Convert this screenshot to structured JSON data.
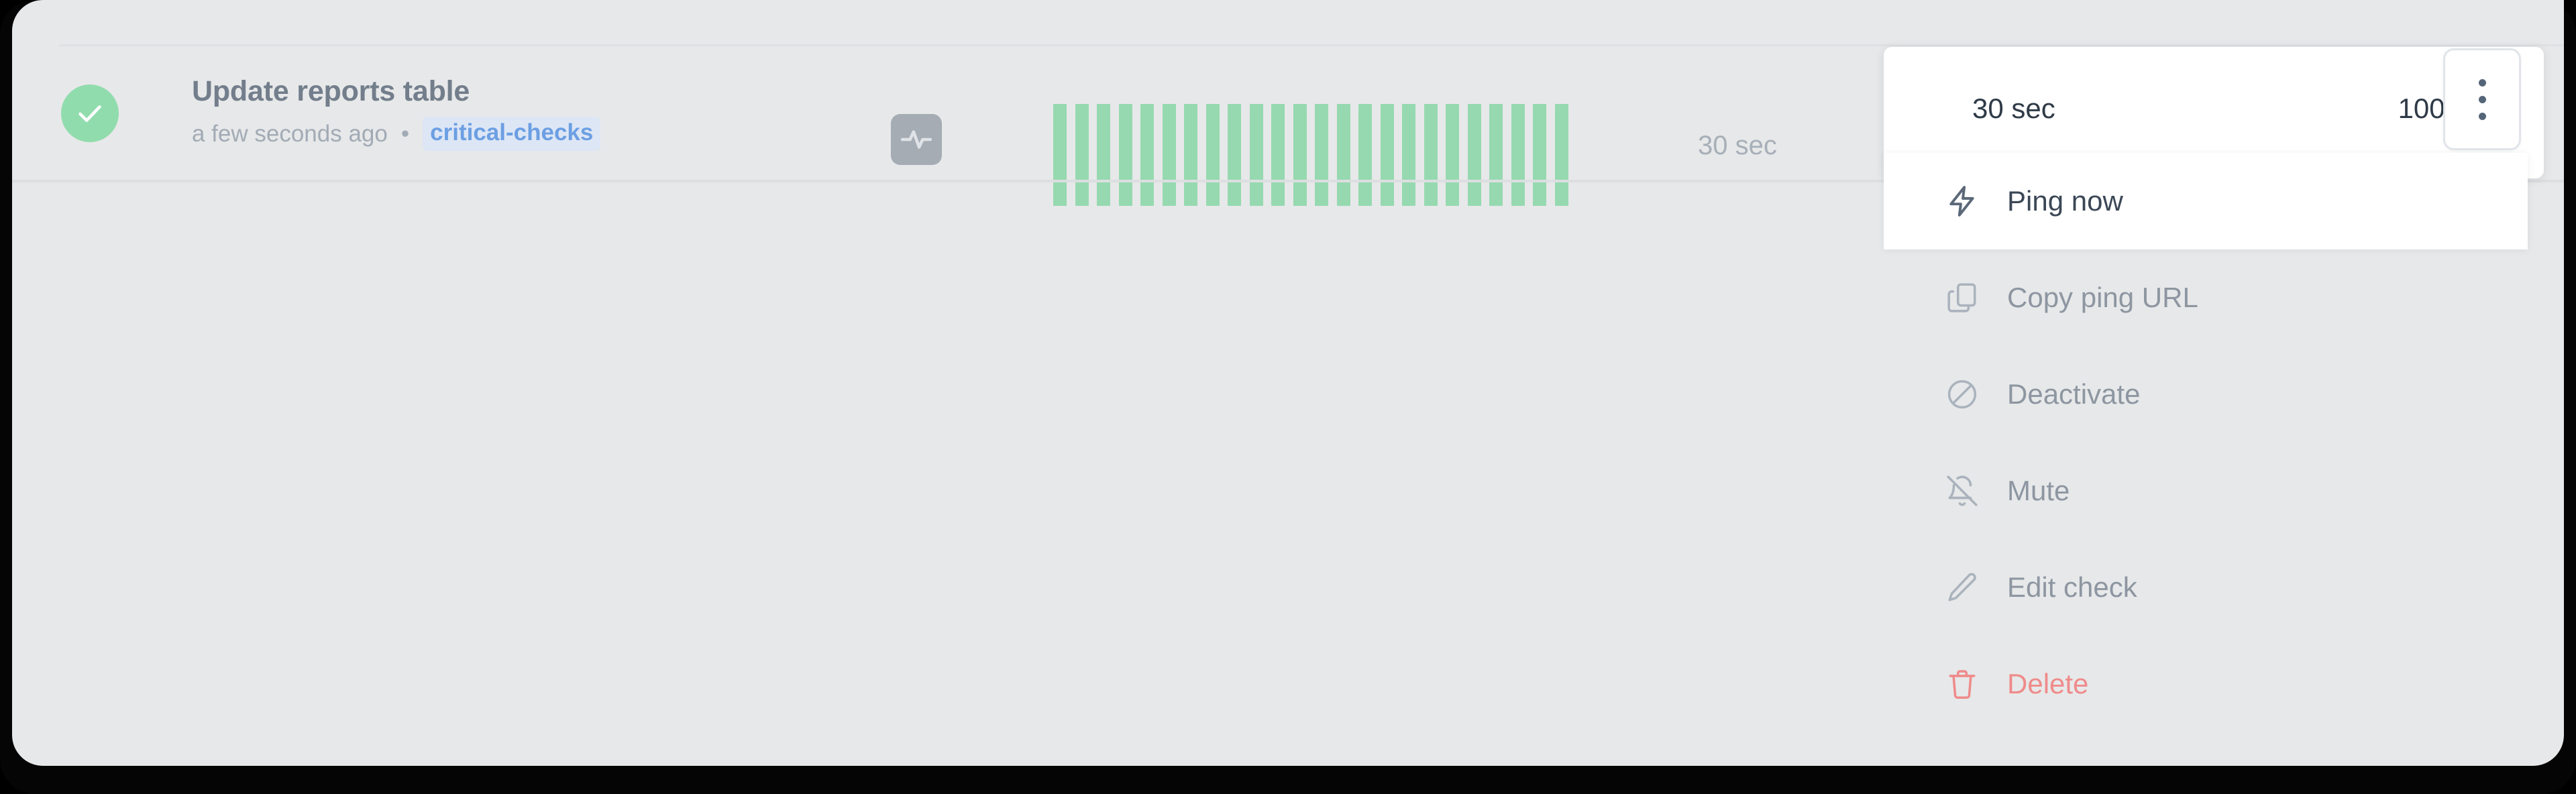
{
  "monitor": {
    "status_icon": "check-circle-icon",
    "status_color": "#91dcad",
    "title": "Update reports table",
    "relative_time": "a few seconds ago",
    "meta_separator": "•",
    "tag": "critical-checks",
    "tag_color": "#6c9fe3",
    "type_icon": "activity-pulse-icon",
    "interval_label": "30 sec"
  },
  "uptime_chart": {
    "bar_color": "#96d9b0",
    "bar_count": 24,
    "all_up": true
  },
  "stats_panel": {
    "interval": "30 sec",
    "uptime": "100%"
  },
  "overflow_button": {
    "icon": "kebab-vertical-icon"
  },
  "context_menu": {
    "items": [
      {
        "label": "Ping now",
        "icon": "lightning-bolt-icon",
        "state": "active"
      },
      {
        "label": "Copy ping URL",
        "icon": "copy-icon",
        "state": "normal"
      },
      {
        "label": "Deactivate",
        "icon": "circle-slash-icon",
        "state": "normal"
      },
      {
        "label": "Mute",
        "icon": "bell-off-icon",
        "state": "normal"
      },
      {
        "label": "Edit check",
        "icon": "pencil-icon",
        "state": "normal"
      },
      {
        "label": "Delete",
        "icon": "trash-icon",
        "state": "danger"
      }
    ],
    "danger_color": "#ef8b8b"
  }
}
